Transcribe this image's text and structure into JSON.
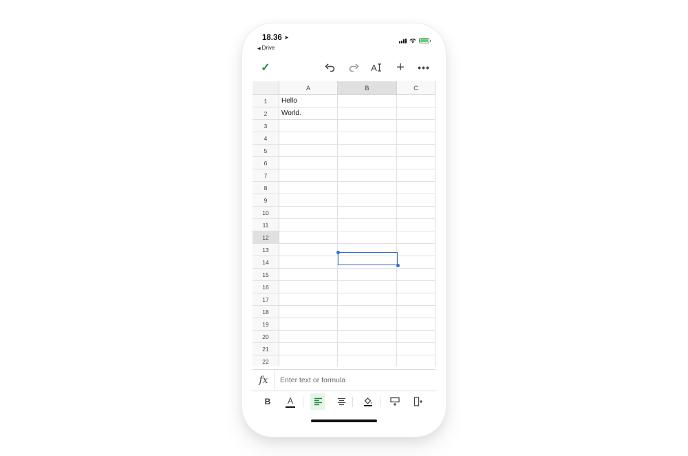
{
  "status_bar": {
    "time": "18.36",
    "back_label": "Drive"
  },
  "toolbar": {
    "confirm_icon": "check-icon",
    "undo_icon": "undo-icon",
    "redo_icon": "redo-icon",
    "format_label": "A",
    "add_icon": "plus-icon",
    "more_icon": "more-icon"
  },
  "sheet": {
    "columns": [
      "A",
      "B",
      "C"
    ],
    "selected_column": "B",
    "selected_row": "12",
    "rows": [
      {
        "num": "1",
        "a": "Hello",
        "b": "",
        "c": ""
      },
      {
        "num": "2",
        "a": "World.",
        "b": "",
        "c": ""
      },
      {
        "num": "3",
        "a": "",
        "b": "",
        "c": ""
      },
      {
        "num": "4",
        "a": "",
        "b": "",
        "c": ""
      },
      {
        "num": "5",
        "a": "",
        "b": "",
        "c": ""
      },
      {
        "num": "6",
        "a": "",
        "b": "",
        "c": ""
      },
      {
        "num": "7",
        "a": "",
        "b": "",
        "c": ""
      },
      {
        "num": "8",
        "a": "",
        "b": "",
        "c": ""
      },
      {
        "num": "9",
        "a": "",
        "b": "",
        "c": ""
      },
      {
        "num": "10",
        "a": "",
        "b": "",
        "c": ""
      },
      {
        "num": "11",
        "a": "",
        "b": "",
        "c": ""
      },
      {
        "num": "12",
        "a": "",
        "b": "",
        "c": ""
      },
      {
        "num": "13",
        "a": "",
        "b": "",
        "c": ""
      },
      {
        "num": "14",
        "a": "",
        "b": "",
        "c": ""
      },
      {
        "num": "15",
        "a": "",
        "b": "",
        "c": ""
      },
      {
        "num": "16",
        "a": "",
        "b": "",
        "c": ""
      },
      {
        "num": "17",
        "a": "",
        "b": "",
        "c": ""
      },
      {
        "num": "18",
        "a": "",
        "b": "",
        "c": ""
      },
      {
        "num": "19",
        "a": "",
        "b": "",
        "c": ""
      },
      {
        "num": "20",
        "a": "",
        "b": "",
        "c": ""
      },
      {
        "num": "21",
        "a": "",
        "b": "",
        "c": ""
      },
      {
        "num": "22",
        "a": "",
        "b": "",
        "c": ""
      }
    ]
  },
  "formula_bar": {
    "fx_label": "fx",
    "placeholder": "Enter text or formula",
    "value": ""
  },
  "format_bar": {
    "bold_label": "B",
    "text_color_label": "A",
    "colors": {
      "accent": "#1e8e3e",
      "selection": "#2f6fd6",
      "active_bg": "#e6f4ea"
    }
  }
}
